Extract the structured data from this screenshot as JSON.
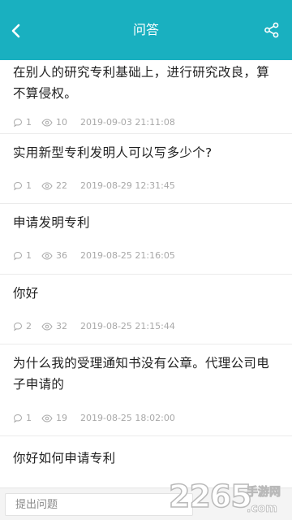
{
  "header": {
    "title": "问答",
    "back_icon": "chevron-left-icon",
    "share_icon": "share-icon",
    "bg_color": "#19b0c0"
  },
  "questions": [
    {
      "title": "在别人的研究专利基础上，进行研究改良，算不算侵权。",
      "answers": "1",
      "views": "10",
      "date": "2019-09-03 21:11:08"
    },
    {
      "title": "实用新型专利发明人可以写多少个?",
      "answers": "1",
      "views": "22",
      "date": "2019-08-29 12:31:45"
    },
    {
      "title": "申请发明专利",
      "answers": "1",
      "views": "36",
      "date": "2019-08-25 21:16:05"
    },
    {
      "title": "你好",
      "answers": "2",
      "views": "32",
      "date": "2019-08-25 21:15:44"
    },
    {
      "title": "为什么我的受理通知书没有公章。代理公司电子申请的",
      "answers": "1",
      "views": "19",
      "date": "2019-08-25 18:02:00"
    },
    {
      "title": "你好如何申请专利"
    }
  ],
  "bottom": {
    "ask_placeholder": "提出问题"
  },
  "watermark": {
    "brand": "2265",
    "suffix": ".com",
    "tagline": "手游网"
  }
}
